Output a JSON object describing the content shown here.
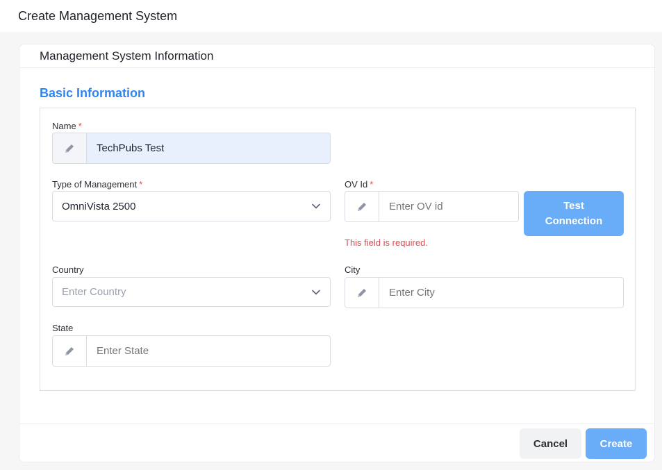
{
  "page": {
    "title": "Create Management System"
  },
  "card": {
    "title": "Management System Information"
  },
  "section": {
    "title": "Basic Information"
  },
  "required_mark": "*",
  "fields": {
    "name": {
      "label": "Name",
      "value": "TechPubs Test"
    },
    "type_of_management": {
      "label": "Type of Management",
      "selected": "OmniVista 2500"
    },
    "ov_id": {
      "label": "OV Id",
      "placeholder": "Enter OV id",
      "error": "This field is required."
    },
    "country": {
      "label": "Country",
      "placeholder": "Enter Country"
    },
    "city": {
      "label": "City",
      "placeholder": "Enter City"
    },
    "state": {
      "label": "State",
      "placeholder": "Enter State"
    }
  },
  "buttons": {
    "test_connection": "Test Connection",
    "cancel": "Cancel",
    "create": "Create"
  },
  "icons": {
    "field_addon": "pencil-icon",
    "select_arrow": "chevron-down-icon"
  },
  "colors": {
    "accent": "#2f86ee",
    "primary_button": "#69adf8",
    "error": "#e5484d",
    "filled_input": "#e8f0fe"
  }
}
